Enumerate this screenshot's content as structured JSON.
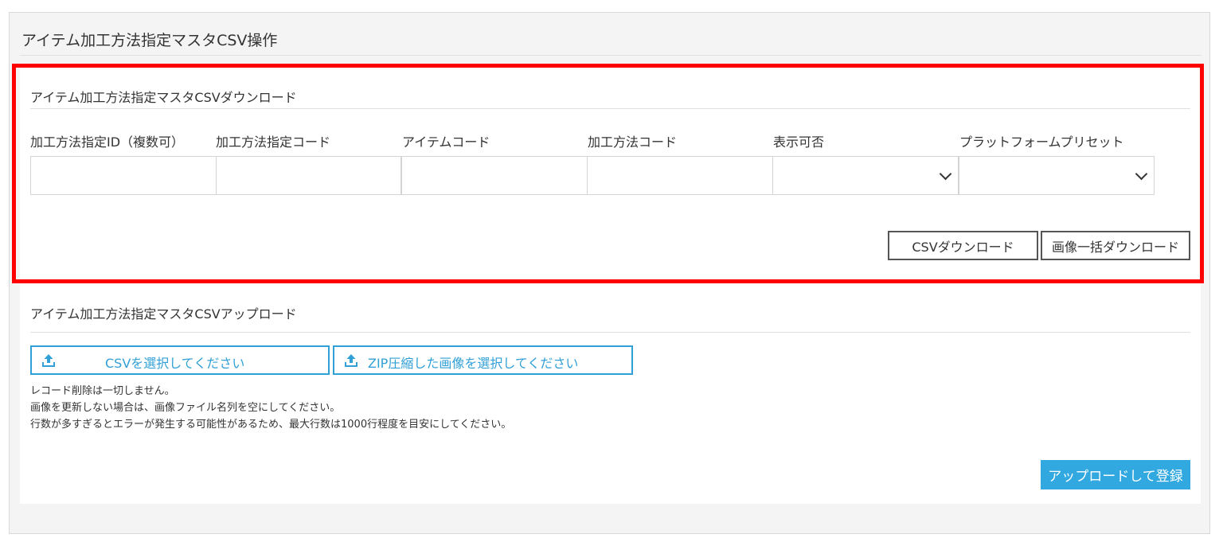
{
  "page": {
    "title": "アイテム加工方法指定マスタCSV操作"
  },
  "download": {
    "title": "アイテム加工方法指定マスタCSVダウンロード",
    "fields": {
      "id_label": "加工方法指定ID（複数可）",
      "id_value": "",
      "code_label": "加工方法指定コード",
      "code_value": "",
      "item_label": "アイテムコード",
      "item_value": "",
      "method_label": "加工方法コード",
      "method_value": "",
      "visible_label": "表示可否",
      "visible_selected": "",
      "platform_label": "プラットフォームプリセット",
      "platform_selected": ""
    },
    "csv_button": "CSVダウンロード",
    "image_button": "画像一括ダウンロード"
  },
  "upload": {
    "title": "アイテム加工方法指定マスタCSVアップロード",
    "csv_select": "CSVを選択してください",
    "zip_select": "ZIP圧縮した画像を選択してください",
    "notes": [
      "レコード削除は一切しません。",
      "画像を更新しない場合は、画像ファイル名列を空にしてください。",
      "行数が多すぎるとエラーが発生する可能性があるため、最大行数は1000行程度を目安にしてください。"
    ],
    "submit": "アップロードして登録"
  },
  "colors": {
    "accent": "#31a8e0",
    "highlight": "#ff0000"
  },
  "icons": {
    "upload": "upload-icon",
    "dropdown": "chevron-down-icon"
  }
}
